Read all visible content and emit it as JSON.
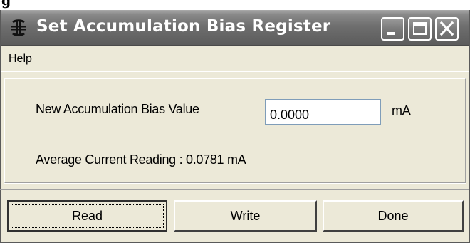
{
  "window": {
    "title": "Set Accumulation Bias Register",
    "icon": "app-icon"
  },
  "caption_buttons": [
    "minimize-icon",
    "maximize-icon",
    "close-icon"
  ],
  "menu": {
    "items": [
      {
        "label": "Help"
      }
    ]
  },
  "form": {
    "bias_label": "New Accumulation Bias Value",
    "bias_value": "0.0000",
    "bias_unit": "mA",
    "average_reading": "Average Current Reading : 0.0781 mA"
  },
  "buttons": {
    "read": "Read",
    "write": "Write",
    "done": "Done"
  },
  "colors": {
    "titlebar": "#6f6f6f",
    "face": "#ece9d8",
    "input_border": "#7f9db9"
  }
}
